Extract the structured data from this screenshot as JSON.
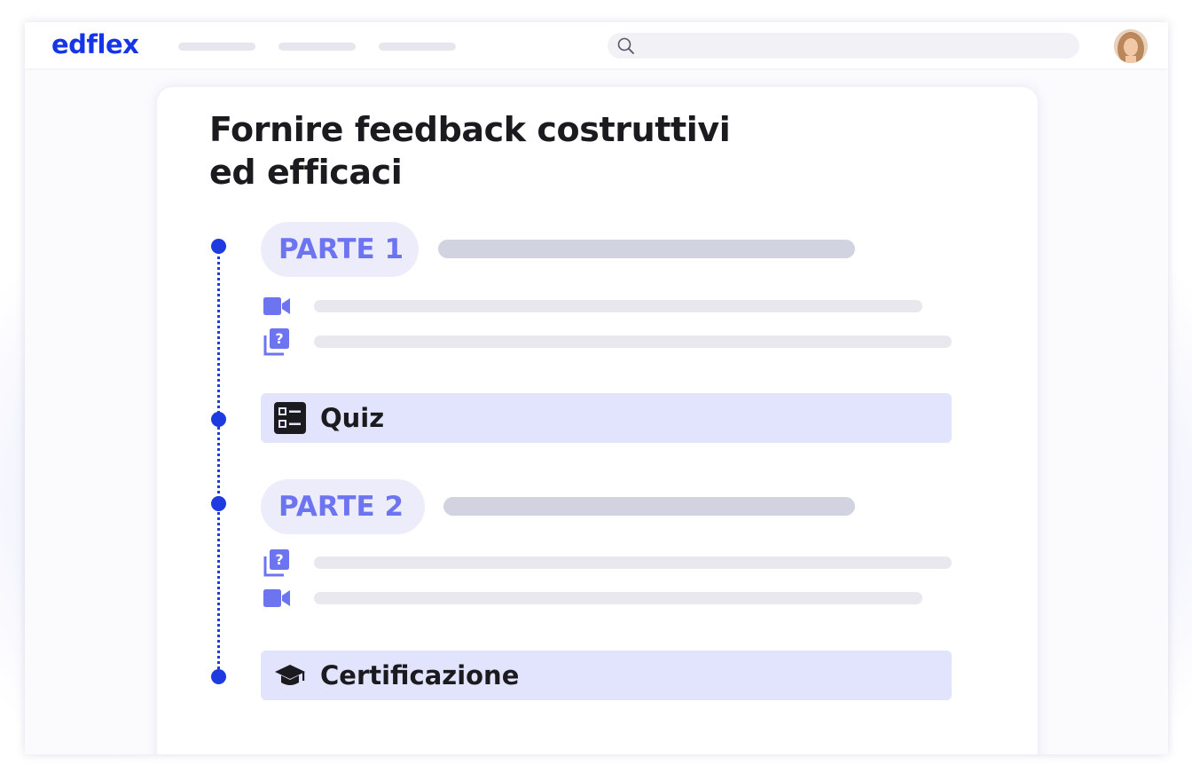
{
  "app": {
    "logo": "edflex"
  },
  "course": {
    "title": "Fornire feedback costruttivi ed efficaci",
    "sections": [
      {
        "label": "PARTE 1",
        "items": [
          "video-icon",
          "quiz-question-icon"
        ]
      },
      {
        "label": "Quiz",
        "icon": "quiz-list-icon"
      },
      {
        "label": "PARTE 2",
        "items": [
          "quiz-question-icon",
          "video-icon"
        ]
      },
      {
        "label": "Certificazione",
        "icon": "graduation-cap-icon"
      }
    ]
  },
  "colors": {
    "accent": "#1635e8",
    "pill_text": "#6d74f0",
    "pill_bg": "#ececfb",
    "bar_bg": "#e2e3fc",
    "title_text": "#1b1b1f"
  }
}
